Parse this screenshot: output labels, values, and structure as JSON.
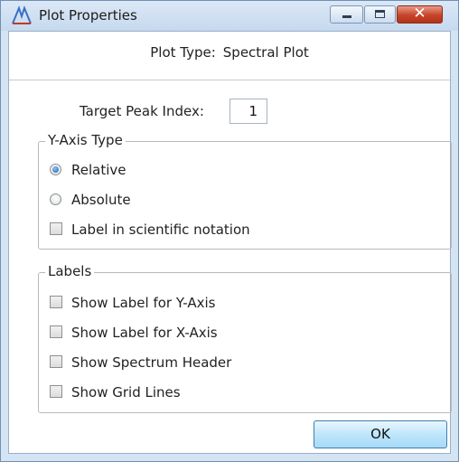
{
  "window": {
    "title": "Plot Properties",
    "icon": "plot-peak-icon",
    "close_glyph": "✕"
  },
  "plot_type": {
    "label": "Plot Type:",
    "value": "Spectral Plot"
  },
  "target_peak": {
    "label": "Target Peak Index:",
    "value": "1"
  },
  "y_axis_group": {
    "legend": "Y-Axis Type",
    "options": [
      {
        "label": "Relative",
        "checked": true
      },
      {
        "label": "Absolute",
        "checked": false
      }
    ],
    "scientific_label": "Label in scientific notation",
    "scientific_checked": false
  },
  "labels_group": {
    "legend": "Labels",
    "items": [
      {
        "label": "Show Label for Y-Axis",
        "checked": false
      },
      {
        "label": "Show Label for X-Axis",
        "checked": false
      },
      {
        "label": "Show Spectrum Header",
        "checked": false
      },
      {
        "label": "Show Grid Lines",
        "checked": false
      }
    ]
  },
  "ok_button": {
    "label": "OK"
  },
  "colors": {
    "titlebar": "#c6d9ee",
    "close_button": "#c7432a",
    "ok_button": "#bee6fd",
    "radio_selected": "#1d5fae"
  }
}
